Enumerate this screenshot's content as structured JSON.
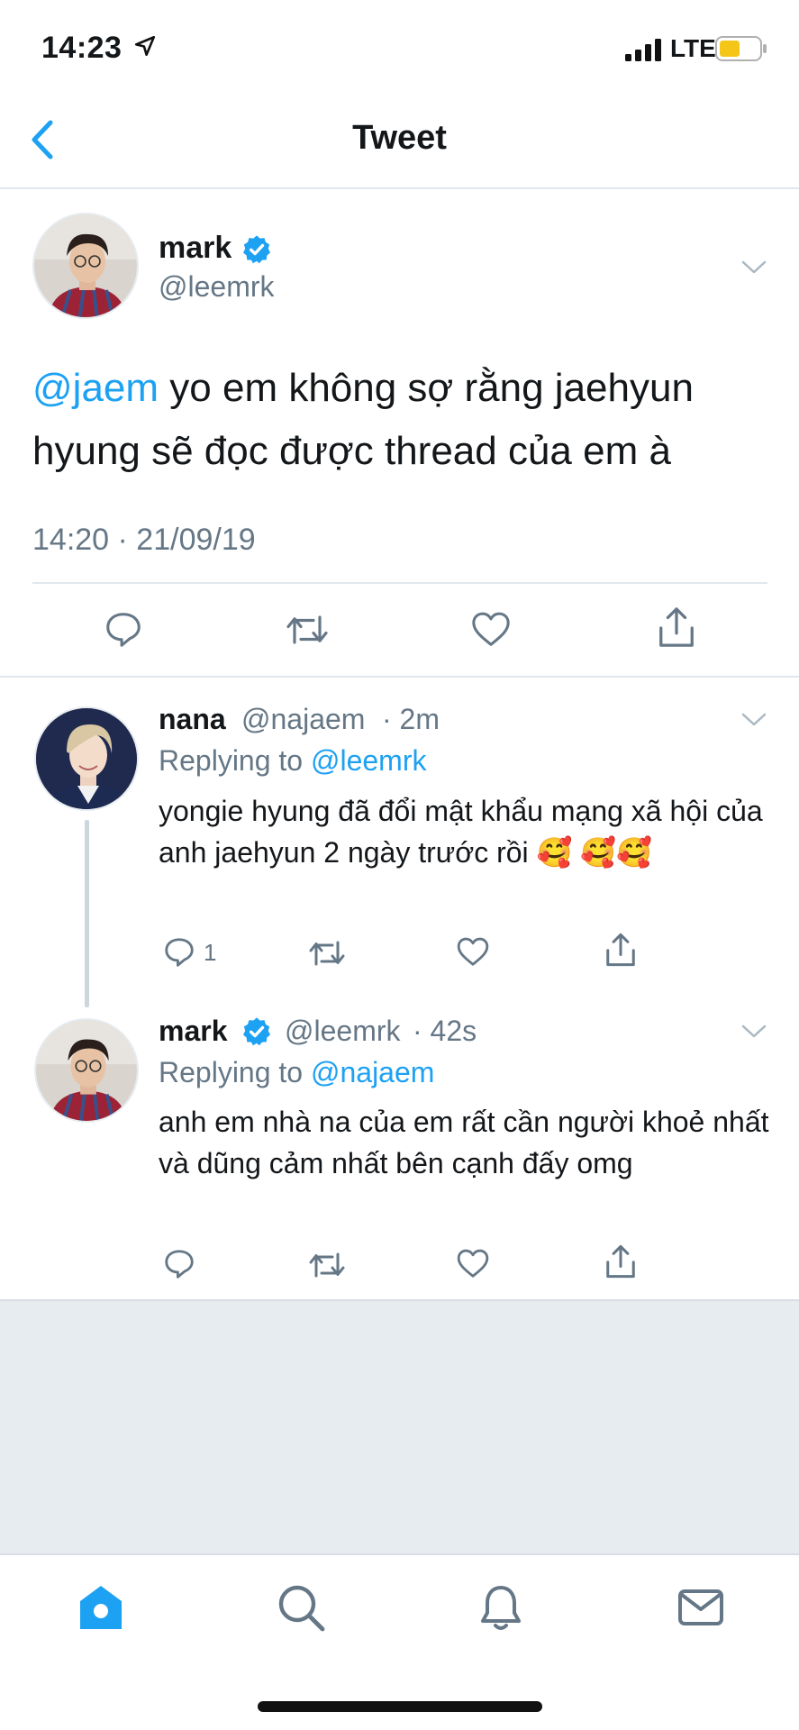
{
  "status_bar": {
    "time": "14:23",
    "network": "LTE",
    "battery_color": "#f5c518"
  },
  "header": {
    "title": "Tweet",
    "back_icon": "chevron-left-icon"
  },
  "main_tweet": {
    "name": "mark",
    "verified": true,
    "handle": "@leemrk",
    "mention": "@jaem",
    "text": " yo em không sợ rằng jaehyun hyung sẽ đọc được thread của em à",
    "timestamp": "14:20 · 21/09/19",
    "actions": [
      "reply-icon",
      "retweet-icon",
      "like-icon",
      "share-icon"
    ]
  },
  "replies": [
    {
      "name": "nana",
      "handle": "@najaem",
      "time": "· 2m",
      "replying_prefix": "Replying to ",
      "replying_to": "@leemrk",
      "text": "yongie hyung đã đổi mật khẩu mạng xã hội của anh jaehyun 2 ngày trước rồi",
      "emoji_line1": "🥰",
      "emoji_line2": "🥰🥰",
      "reply_count": "1"
    },
    {
      "name": "mark",
      "handle": "@leemrk",
      "time": "· 42s",
      "replying_prefix": "Replying to ",
      "replying_to": "@najaem",
      "text": "anh em nhà na của em rất cần người khoẻ nhất và dũng cảm nhất bên cạnh đấy omg",
      "verified": true
    }
  ],
  "tab_bar": {
    "tabs": [
      "home-icon",
      "search-icon",
      "notifications-icon",
      "messages-icon"
    ],
    "active": "home-icon",
    "accent": "#1da1f2"
  },
  "colors": {
    "accent": "#1da1f2",
    "secondary_text": "#657786",
    "divider": "#e1e8ed",
    "empty_area": "#e6ecf0"
  }
}
